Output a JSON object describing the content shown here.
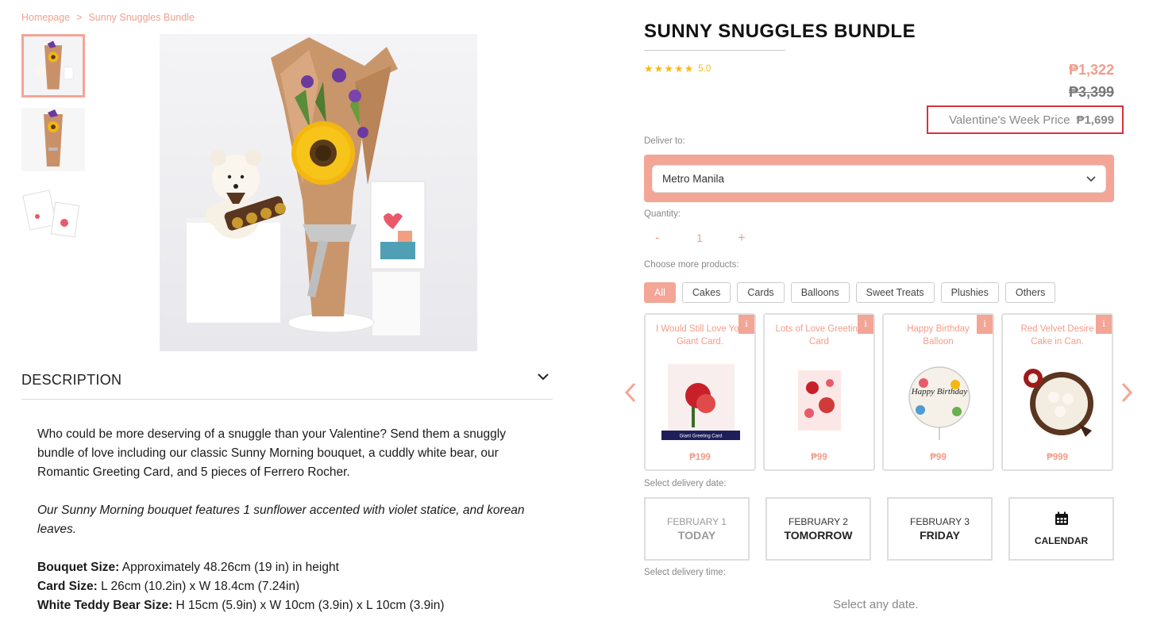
{
  "breadcrumb": {
    "home": "Homepage",
    "separator": ">",
    "current": "Sunny Snuggles Bundle"
  },
  "gallery": {
    "thumbnails": [
      "bouquet-with-bear",
      "bouquet-alone",
      "greeting-card"
    ],
    "active_index": 0
  },
  "description": {
    "title": "DESCRIPTION",
    "paragraph1": "Who could be more deserving of a snuggle than your Valentine? Send them a snuggly bundle of love including our classic Sunny Morning bouquet, a cuddly white bear, our Romantic Greeting Card, and 5 pieces of Ferrero Rocher.",
    "paragraph2": "Our Sunny Morning bouquet features 1 sunflower accented with violet statice, and korean leaves.",
    "specs": [
      {
        "label": "Bouquet Size:",
        "value": " Approximately 48.26cm (19 in) in height"
      },
      {
        "label": "Card Size:",
        "value": " L 26cm (10.2in) x W 18.4cm (7.24in)"
      },
      {
        "label": "White Teddy Bear Size:",
        "value": " H 15cm (5.9in) x W 10cm (3.9in) x L 10cm (3.9in)"
      }
    ]
  },
  "product": {
    "title": "SUNNY SNUGGLES BUNDLE",
    "rating": {
      "stars": 5,
      "value": "5.0"
    },
    "price_now": "₱1,322",
    "price_old": "₱3,399",
    "valentine_label": "Valentine's Week Price",
    "valentine_price": "₱1,699"
  },
  "delivery": {
    "deliver_to_label": "Deliver to:",
    "location": "Metro Manila",
    "quantity_label": "Quantity:",
    "quantity": "1",
    "minus": "-",
    "plus": "+"
  },
  "more_products": {
    "label": "Choose more products:",
    "categories": [
      "All",
      "Cakes",
      "Cards",
      "Balloons",
      "Sweet Treats",
      "Plushies",
      "Others"
    ],
    "active_category": "All",
    "items": [
      {
        "name": "I Would Still Love You Giant Card.",
        "price": "₱199",
        "image_caption": "Giant Greeting Card"
      },
      {
        "name": "Lots of Love Greeting Card",
        "price": "₱99"
      },
      {
        "name": "Happy Birthday Balloon",
        "price": "₱99",
        "image_caption": "Happy Birthday"
      },
      {
        "name": "Red Velvet Desire Cake in Can.",
        "price": "₱999"
      }
    ],
    "info_glyph": "i"
  },
  "delivery_date": {
    "label": "Select delivery date:",
    "options": [
      {
        "month": "FEBRUARY 1",
        "day": "TODAY"
      },
      {
        "month": "FEBRUARY 2",
        "day": "TOMORROW"
      },
      {
        "month": "FEBRUARY 3",
        "day": "FRIDAY"
      }
    ],
    "calendar_label": "CALENDAR"
  },
  "delivery_time": {
    "label": "Select delivery time:",
    "placeholder": "Select any date."
  },
  "colors": {
    "accent": "#f3a596",
    "accent_text": "#f39c8a",
    "star": "#f5b921",
    "highlight_border": "#d8333a"
  }
}
